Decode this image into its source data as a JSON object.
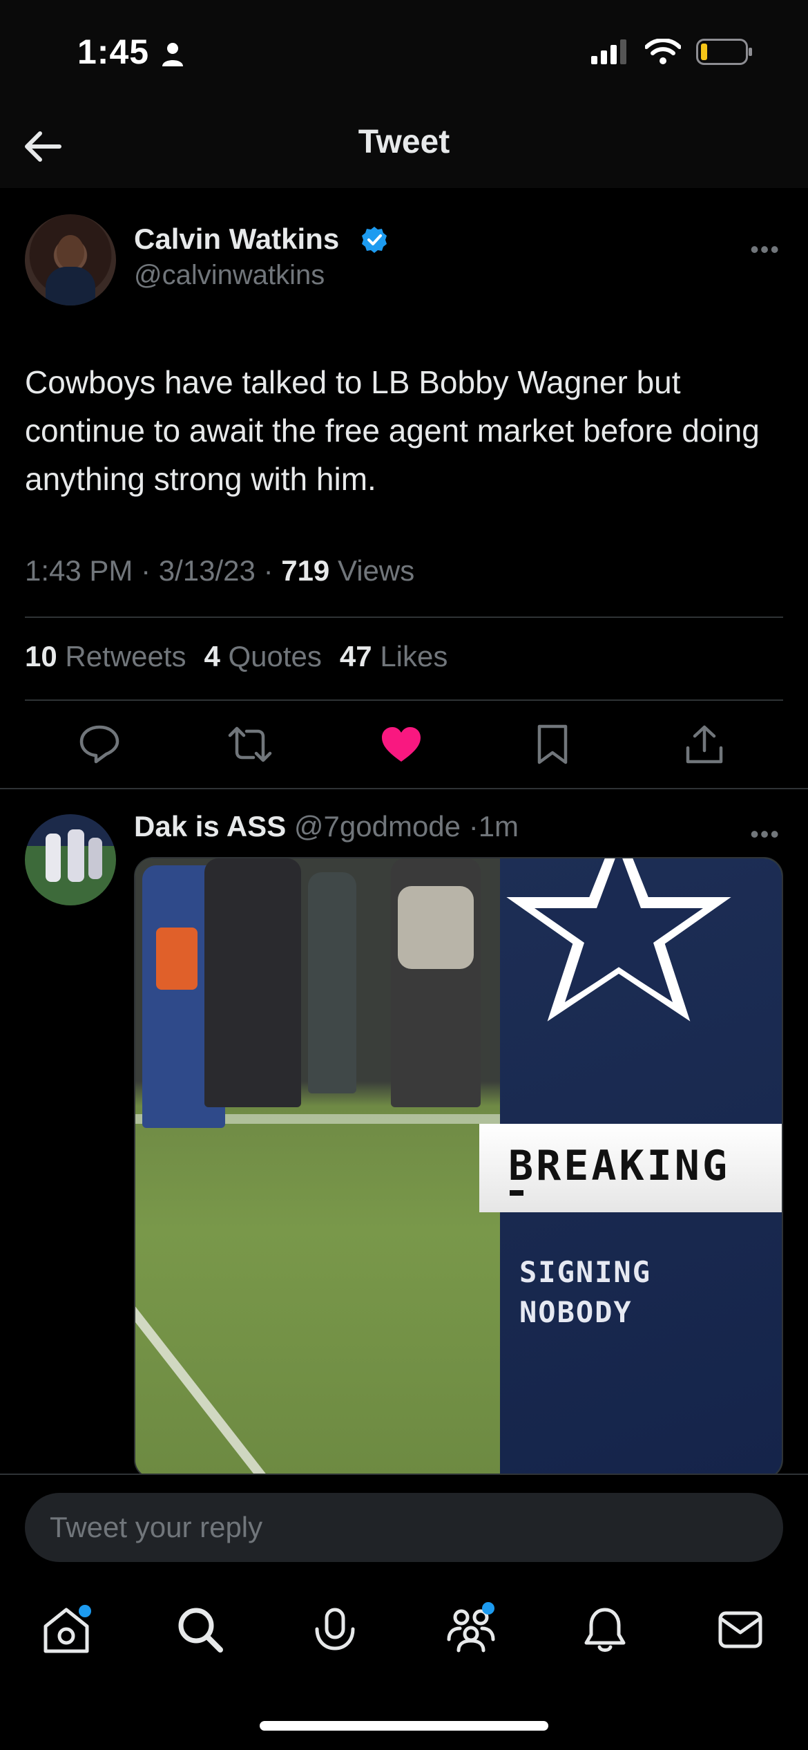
{
  "status_bar": {
    "time": "1:45"
  },
  "header": {
    "title": "Tweet"
  },
  "tweet": {
    "author_name": "Calvin Watkins",
    "author_handle": "@calvinwatkins",
    "text": "Cowboys have talked to LB Bobby Wagner but continue to await the free agent market before doing anything strong with him.",
    "time": "1:43 PM",
    "date": "3/13/23",
    "views_count": "719",
    "views_label": "Views",
    "retweets_count": "10",
    "retweets_label": "Retweets",
    "quotes_count": "4",
    "quotes_label": "Quotes",
    "likes_count": "47",
    "likes_label": "Likes",
    "liked": true
  },
  "reply_tweet": {
    "author_name": "Dak is ASS",
    "author_handle": "@7godmode",
    "age": "1m",
    "media": {
      "headline": "BREAKING",
      "line1": "SIGNING",
      "line2": "NOBODY"
    }
  },
  "reply_bar": {
    "placeholder": "Tweet your reply"
  },
  "colors": {
    "accent": "#1d9bf0",
    "like": "#f91880",
    "background": "#000000"
  },
  "tabs": [
    "home-icon",
    "search-icon",
    "spaces-icon",
    "communities-icon",
    "notifications-icon",
    "messages-icon"
  ]
}
